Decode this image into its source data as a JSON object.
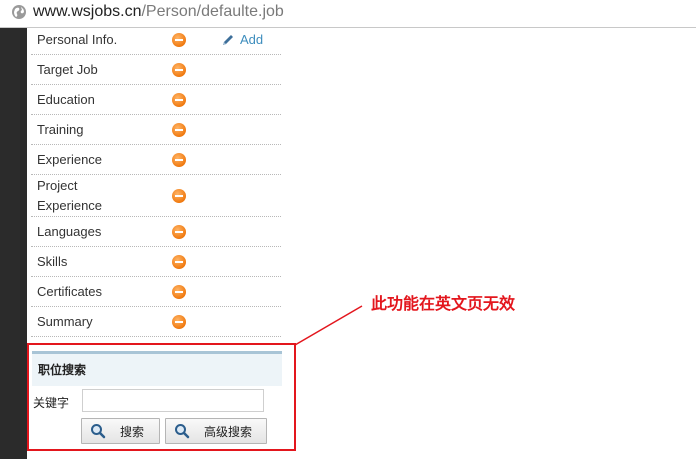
{
  "address_bar": {
    "domain": "www.wsjobs.cn",
    "path": "/Person/defaulte.job",
    "icon": "globe-icon"
  },
  "menu": {
    "add_label": "Add",
    "items": [
      {
        "label": "Personal Info."
      },
      {
        "label": "Target Job"
      },
      {
        "label": "Education"
      },
      {
        "label": "Training"
      },
      {
        "label": "Experience"
      },
      {
        "label": "Project Experience"
      },
      {
        "label": "Languages"
      },
      {
        "label": "Skills"
      },
      {
        "label": "Certificates"
      },
      {
        "label": "Summary"
      }
    ]
  },
  "job_search": {
    "title": "职位搜索",
    "keyword_label": "关键字",
    "keyword_value": "",
    "search_button": "搜索",
    "advanced_button": "高级搜索"
  },
  "annotation": {
    "text": "此功能在英文页无效",
    "color": "#e3161d"
  },
  "colors": {
    "status_icon": "#f07a10",
    "link": "#3d8dbd",
    "header_bg": "#edf4f8"
  }
}
